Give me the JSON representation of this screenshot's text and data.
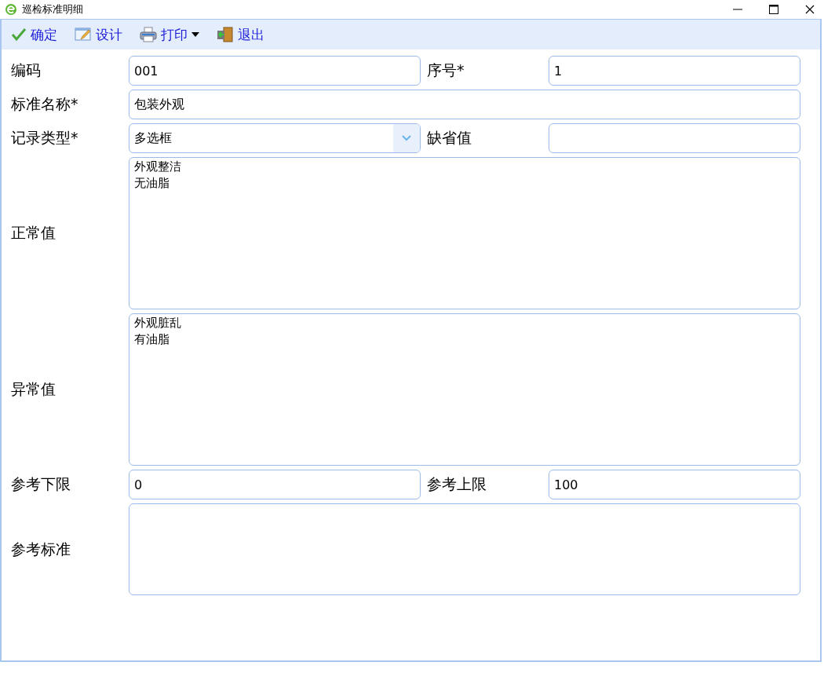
{
  "window": {
    "title": "巡检标准明细"
  },
  "toolbar": [
    {
      "kind": "check",
      "label": "确定"
    },
    {
      "kind": "design",
      "label": "设计"
    },
    {
      "kind": "print",
      "label": "打印",
      "dropdown": true
    },
    {
      "kind": "exit",
      "label": "退出"
    }
  ],
  "form": [
    {
      "kind": "pair",
      "fields": [
        {
          "label": "编码",
          "kind": "text",
          "value": "001"
        },
        {
          "label": "序号*",
          "kind": "text",
          "value": "1"
        }
      ]
    },
    {
      "kind": "single",
      "fields": [
        {
          "label": "标准名称*",
          "kind": "text",
          "value": "包装外观"
        }
      ]
    },
    {
      "kind": "pair",
      "fields": [
        {
          "label": "记录类型*",
          "kind": "select",
          "value": "多选框"
        },
        {
          "label": "缺省值",
          "kind": "text"
        }
      ]
    },
    {
      "kind": "tall",
      "fields": [
        {
          "label": "正常值",
          "kind": "textarea",
          "lines": [
            "外观整洁",
            "无油脂"
          ]
        }
      ]
    },
    {
      "kind": "tall",
      "fields": [
        {
          "label": "异常值",
          "kind": "textarea",
          "lines": [
            "外观脏乱",
            "有油脂"
          ]
        }
      ]
    },
    {
      "kind": "pair",
      "fields": [
        {
          "label": "参考下限",
          "kind": "text",
          "value": "0"
        },
        {
          "label": "参考上限",
          "kind": "text",
          "value": "100"
        }
      ]
    },
    {
      "kind": "medium",
      "fields": [
        {
          "label": "参考标准",
          "kind": "textarea"
        }
      ]
    }
  ]
}
